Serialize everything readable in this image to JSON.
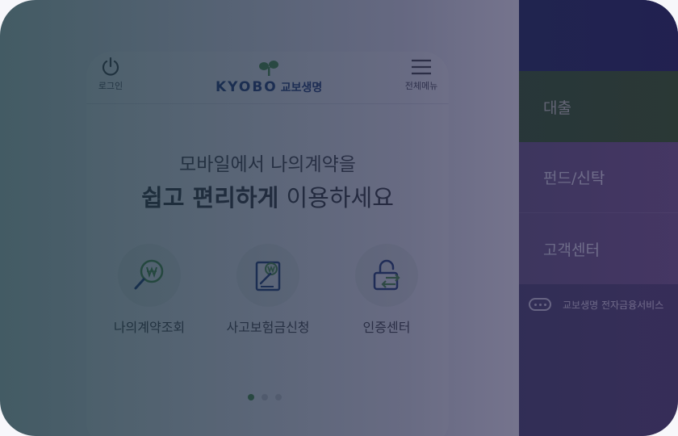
{
  "header": {
    "login_label": "로그인",
    "menu_label": "전체메뉴",
    "logo_text": "KYOBO",
    "logo_kr": "교보생명"
  },
  "hero": {
    "line1": "모바일에서 나의계약을",
    "line2_bold": "쉽고 편리하게",
    "line2_rest": " 이용하세요"
  },
  "quick_menu": [
    {
      "label": "나의계약조회",
      "icon": "search-won-icon"
    },
    {
      "label": "사고보험금신청",
      "icon": "document-won-icon"
    },
    {
      "label": "인증센터",
      "icon": "unlock-icon"
    }
  ],
  "pager": {
    "count": 3,
    "active": 1
  },
  "side_menu": {
    "items": [
      {
        "label": "대출",
        "color": "#1f4d12"
      },
      {
        "label": "펀드/신탁",
        "color": "#5a4b78"
      },
      {
        "label": "고객센터",
        "color": "#5a4b78"
      }
    ],
    "footer": "교보생명 전자금융서비스",
    "top_color": "#0b1a4e"
  },
  "colors": {
    "brand_green": "#3f8f2f",
    "brand_navy": "#0d2a6e"
  }
}
